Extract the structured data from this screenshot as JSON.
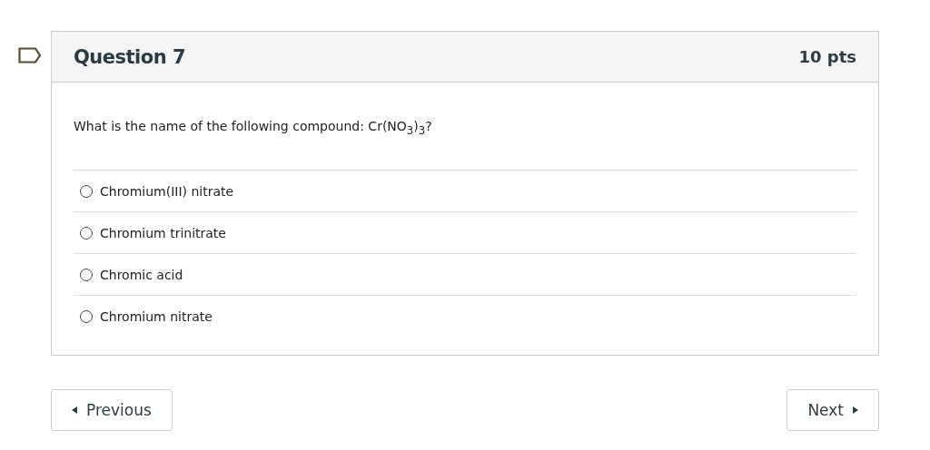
{
  "question": {
    "title": "Question 7",
    "points": "10 pts",
    "text": "What is the name of the following compound: Cr(NO$_{3}$)$_{3}$?",
    "answers": [
      {
        "label": "Chromium(III) nitrate",
        "selected": false
      },
      {
        "label": "Chromium trinitrate",
        "selected": false
      },
      {
        "label": "Chromic acid",
        "selected": false
      },
      {
        "label": "Chromium nitrate",
        "selected": false
      }
    ]
  },
  "navigation": {
    "previous": "Previous",
    "next": "Next"
  }
}
